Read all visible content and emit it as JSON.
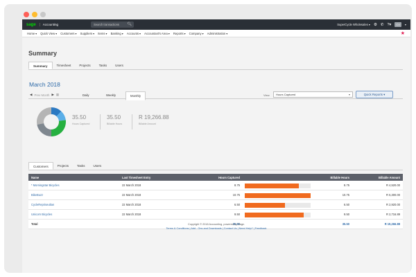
{
  "window_dots": [
    "#fe5f57",
    "#febc2e",
    "#c8c8c8"
  ],
  "topbar": {
    "logo": "sage",
    "app_name": "Accounting",
    "search_placeholder": "Search transactions",
    "company": "SuperCycle Wholesales",
    "user_initials": "CV"
  },
  "menu": [
    "Home",
    "Quick View",
    "Customers",
    "Suppliers",
    "Items",
    "Banking",
    "Accounts",
    "Accountant's Area",
    "Reports",
    "Company",
    "Administration"
  ],
  "page_title": "Summary",
  "main_tabs": [
    "Summary",
    "Timesheet",
    "Projects",
    "Tasks",
    "Users"
  ],
  "period_title": "March 2018",
  "period_nav": {
    "prev_label": "Prev Month"
  },
  "period_tabs": [
    "Daily",
    "Weekly",
    "Monthly"
  ],
  "view": {
    "label": "View",
    "selected": "Hours Captured"
  },
  "quick_reports": "Quick Reports",
  "donut": [
    {
      "value": 12,
      "color": "#2b79c2"
    },
    {
      "value": 11,
      "color": "#5aaee8"
    },
    {
      "value": 27,
      "color": "#26b040"
    },
    {
      "value": 22,
      "color": "#7f878f"
    },
    {
      "value": 28,
      "color": "#b5b5b5"
    }
  ],
  "stats": [
    {
      "value": "35.50",
      "label": "Hours Captured"
    },
    {
      "value": "35.50",
      "label": "Billable Hours"
    },
    {
      "value": "R 19,266.88",
      "label": "Billable Amount"
    }
  ],
  "sub_tabs": [
    "Customers",
    "Projects",
    "Tasks",
    "Users"
  ],
  "table": {
    "headers": [
      "Name",
      "Last Timesheet Entry",
      "Hours Captured",
      "Billable Hours",
      "Billable Amount"
    ],
    "rows": [
      {
        "name": "* Morningstar Bicycles",
        "last": "22 March 2018",
        "hours": "8.75",
        "pct": 82,
        "billable": "8.75",
        "amount": "R 4,520.00"
      },
      {
        "name": "BikeBuzz",
        "last": "22 March 2018",
        "hours": "10.75",
        "pct": 100,
        "billable": "10.75",
        "amount": "R 6,300.00"
      },
      {
        "name": "CycleRepriseultan",
        "last": "22 March 2018",
        "hours": "6.50",
        "pct": 61,
        "billable": "6.50",
        "amount": "R 2,920.00"
      },
      {
        "name": "Unicorn Bicycles",
        "last": "22 March 2018",
        "hours": "9.50",
        "pct": 89,
        "billable": "9.50",
        "amount": "R 2,716.89"
      }
    ],
    "total": {
      "label": "Total",
      "hours": "35.50",
      "billable": "35.50",
      "amount": "R 19,266.88"
    }
  },
  "footer": {
    "copyright": "Copyright © 2018 Accounting, powered by Sage.",
    "links": "Terms & Conditions | Add - Ons and Downloads | Contact Us | Need Help? | Feedback"
  }
}
